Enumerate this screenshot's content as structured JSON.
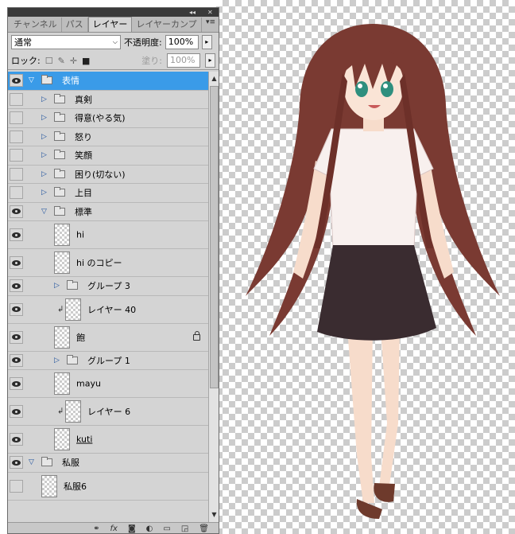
{
  "panel": {
    "tabs": [
      "チャンネル",
      "パス",
      "レイヤー",
      "レイヤーカンプ"
    ],
    "active_tab": "レイヤー",
    "blend_mode": "通常",
    "opacity_label": "不透明度:",
    "opacity_value": "100%",
    "lock_label": "ロック:",
    "fill_label": "塗り:",
    "fill_value": "100%"
  },
  "layers": [
    {
      "name": "表情",
      "type": "group",
      "state": "open",
      "visible": true,
      "selected": true,
      "indent": 0
    },
    {
      "name": "真剣",
      "type": "group",
      "state": "closed",
      "visible": false,
      "indent": 1
    },
    {
      "name": "得意(やる気)",
      "type": "group",
      "state": "closed",
      "visible": false,
      "indent": 1
    },
    {
      "name": "怒り",
      "type": "group",
      "state": "closed",
      "visible": false,
      "indent": 1
    },
    {
      "name": "笑顔",
      "type": "group",
      "state": "closed",
      "visible": false,
      "indent": 1
    },
    {
      "name": "困り(切ない)",
      "type": "group",
      "state": "closed",
      "visible": false,
      "indent": 1
    },
    {
      "name": "上目",
      "type": "group",
      "state": "closed",
      "visible": false,
      "indent": 1
    },
    {
      "name": "標準",
      "type": "group",
      "state": "open",
      "visible": true,
      "indent": 1
    },
    {
      "name": "hi",
      "type": "layer",
      "visible": true,
      "indent": 2
    },
    {
      "name": "hi のコピー",
      "type": "layer",
      "visible": true,
      "indent": 2
    },
    {
      "name": "グループ 3",
      "type": "group",
      "state": "closed",
      "visible": true,
      "indent": 2
    },
    {
      "name": "レイヤー 40",
      "type": "layer",
      "visible": true,
      "indent": 2,
      "clipped": true
    },
    {
      "name": "飽",
      "type": "layer",
      "visible": true,
      "indent": 2,
      "locked": true
    },
    {
      "name": "グループ 1",
      "type": "group",
      "state": "closed",
      "visible": true,
      "indent": 2
    },
    {
      "name": "mayu",
      "type": "layer",
      "visible": true,
      "indent": 2
    },
    {
      "name": "レイヤー 6",
      "type": "layer",
      "visible": true,
      "indent": 2,
      "clipped": true
    },
    {
      "name": "kuti",
      "type": "layer",
      "visible": true,
      "indent": 2
    },
    {
      "name": "私服",
      "type": "group",
      "state": "open",
      "visible": true,
      "indent": 0
    },
    {
      "name": "私服6",
      "type": "layer",
      "visible": false,
      "indent": 1
    }
  ],
  "bottom_icons": [
    "link-icon",
    "fx-icon",
    "mask-icon",
    "adjustment-icon",
    "new-group-icon",
    "new-layer-icon",
    "trash-icon"
  ],
  "colors": {
    "selection": "#3a9be8",
    "panel_bg": "#d4d4d4",
    "hair": "#7a3a32",
    "skirt": "#3a2c30"
  }
}
